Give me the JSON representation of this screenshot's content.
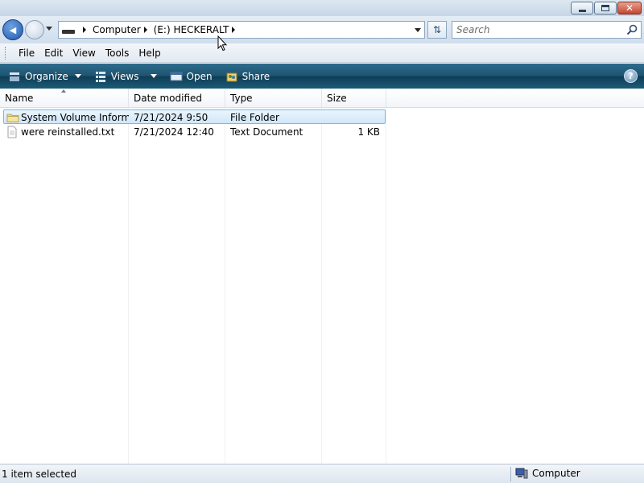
{
  "window": {
    "minimize_label": "",
    "close_glyph": "✕"
  },
  "navigation": {
    "back_glyph": "◀",
    "breadcrumbs": [
      "Computer",
      "(E:) HECKERALT"
    ],
    "refresh_glyph": "⇅",
    "search_placeholder": "Search"
  },
  "menu": {
    "items": [
      "File",
      "Edit",
      "View",
      "Tools",
      "Help"
    ]
  },
  "commands": {
    "organize": "Organize",
    "views": "Views",
    "open": "Open",
    "share": "Share",
    "help_glyph": "?"
  },
  "columns": [
    "Name",
    "Date modified",
    "Type",
    "Size"
  ],
  "files": [
    {
      "name": "System Volume Inform...",
      "date": "7/21/2024 9:50",
      "type": "File Folder",
      "size": "",
      "icon": "folder-icon",
      "selected": true
    },
    {
      "name": "were reinstalled.txt",
      "date": "7/21/2024 12:40",
      "type": "Text Document",
      "size": "1 KB",
      "icon": "text-document-icon",
      "selected": false
    }
  ],
  "status": {
    "selection": "1 item selected",
    "location": "Computer"
  },
  "colors": {
    "command_bar": "#1f5572",
    "selection_border": "#7cb6e6",
    "selection_fill": "#cfe7fa"
  }
}
